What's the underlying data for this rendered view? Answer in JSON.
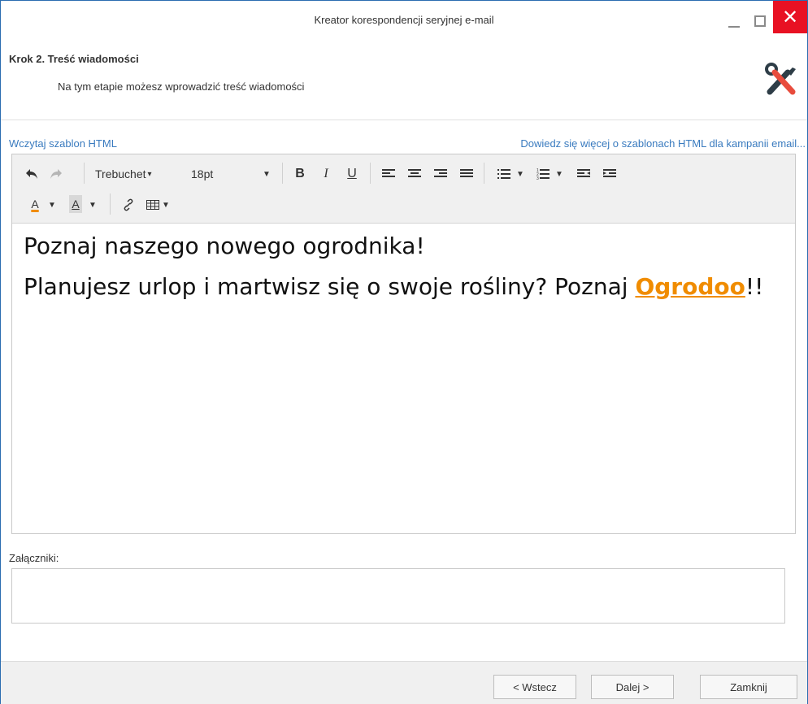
{
  "window": {
    "title": "Kreator korespondencji seryjnej e-mail"
  },
  "header": {
    "step_title": "Krok 2. Treść wiadomości",
    "step_subtitle": "Na tym etapie możesz wprowadzić treść wiadomości"
  },
  "links": {
    "load_template": "Wczytaj szablon HTML",
    "learn_more": "Dowiedz się więcej o szablonach HTML dla kampanii email..."
  },
  "toolbar": {
    "font_family": "Trebuchet",
    "font_size": "18pt",
    "bold": "B",
    "italic": "I",
    "underline": "U",
    "font_color": "A",
    "highlight": "A"
  },
  "editor": {
    "line1": "Poznaj naszego nowego ogrodnika!",
    "line2_text": "Planujesz urlop i martwisz się o swoje rośliny? Poznaj",
    "brand": "Ogrodoo",
    "brand_suffix": "!!",
    "brand_color": "#f08c00"
  },
  "attachments": {
    "label": "Załączniki:"
  },
  "footer": {
    "back": "< Wstecz",
    "next": "Dalej >",
    "close": "Zamknij"
  },
  "colors": {
    "accent": "#3a7bbf",
    "close_button": "#e81123"
  }
}
